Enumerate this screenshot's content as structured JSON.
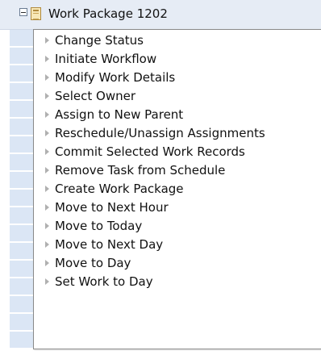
{
  "header": {
    "title": "Work Package 1202",
    "expander_icon": "collapse-icon",
    "item_icon": "work-package-icon"
  },
  "context_menu": {
    "items": [
      {
        "label": "Change Status"
      },
      {
        "label": "Initiate Workflow"
      },
      {
        "label": "Modify Work Details"
      },
      {
        "label": "Select Owner"
      },
      {
        "label": "Assign to New Parent"
      },
      {
        "label": "Reschedule/Unassign Assignments"
      },
      {
        "label": "Commit Selected Work Records"
      },
      {
        "label": "Remove Task from Schedule"
      },
      {
        "label": "Create Work Package"
      },
      {
        "label": "Move to Next Hour"
      },
      {
        "label": "Move to Today"
      },
      {
        "label": "Move to Next Day"
      },
      {
        "label": "Move to Day"
      },
      {
        "label": "Set Work to Day"
      }
    ],
    "item_icon": "submenu-arrow-icon"
  },
  "colors": {
    "header_background": "#e6ecf5",
    "row_stripe": "#dbe6f5",
    "menu_border": "#8a8a8a",
    "arrow": "#b0b0b0"
  }
}
